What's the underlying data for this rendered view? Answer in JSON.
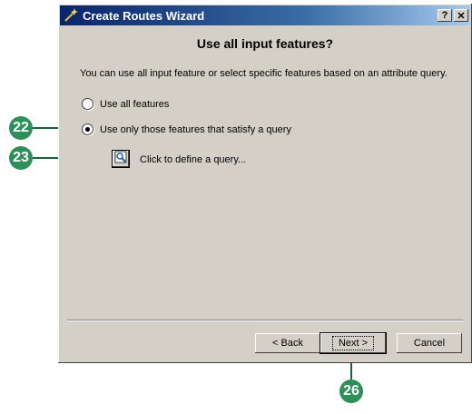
{
  "window": {
    "title": "Create Routes Wizard",
    "help_button": "?",
    "close_button": "✕"
  },
  "page": {
    "heading": "Use all input features?",
    "description": "You can use all input feature or select specific features based on an attribute query."
  },
  "options": [
    {
      "label": "Use all features",
      "selected": false
    },
    {
      "label": "Use only those features that satisfy a query",
      "selected": true
    }
  ],
  "query": {
    "label": "Click to define a query..."
  },
  "buttons": {
    "back": "< Back",
    "next": "Next >",
    "cancel": "Cancel"
  },
  "callouts": [
    "22",
    "23",
    "26"
  ],
  "colors": {
    "dialog_bg": "#d4d0c8",
    "title_start": "#0a246a",
    "callout": "#2f8f5a"
  }
}
